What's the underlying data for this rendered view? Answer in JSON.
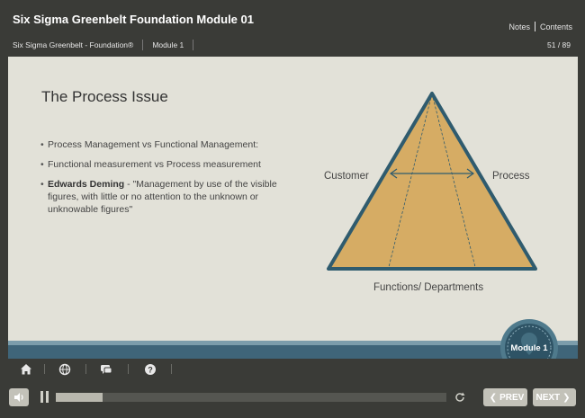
{
  "course": {
    "title": "Six Sigma Greenbelt Foundation Module 01",
    "notes_label": "Notes",
    "contents_label": "Contents"
  },
  "breadcrumb": {
    "course": "Six Sigma Greenbelt - Foundation®",
    "module": "Module 1"
  },
  "page_counter": "51 / 89",
  "slide": {
    "title": "The Process Issue",
    "bullets": [
      {
        "bold": "",
        "text": "Process Management vs Functional Management:"
      },
      {
        "bold": "",
        "text": "Functional measurement vs Process measurement"
      },
      {
        "bold": "Edwards Deming",
        "text": " - \"Management by use of the visible figures, with little or no attention to the unknown or unknowable figures\""
      }
    ],
    "diagram": {
      "left_label": "Customer",
      "right_label": "Process",
      "bottom_label": "Functions/ Departments",
      "fill_color": "#d6ac64",
      "stroke_color": "#2f5b6e"
    }
  },
  "module_badge": "Module 1",
  "toolbar": {
    "icons": [
      "home-icon",
      "globe-icon",
      "chat-icon",
      "help-icon"
    ]
  },
  "player": {
    "progress_fraction": 0.12,
    "prev_label": "PREV",
    "next_label": "NEXT"
  },
  "colors": {
    "background": "#3a3b37",
    "slide_bg": "#e2e1d8",
    "accent": "#3f6579"
  }
}
